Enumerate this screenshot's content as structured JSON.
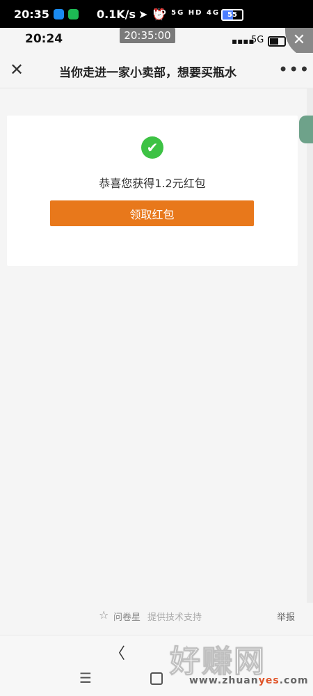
{
  "status_bar": {
    "time": "20:35",
    "speed": "0.1K/s",
    "network_icons": "HD 5G HD 4G",
    "battery": "55",
    "battery_level": 0.55
  },
  "inner_status": {
    "time": "20:24",
    "network": "5G"
  },
  "overlay_time": "20:35:00",
  "nav": {
    "title": "当你走进一家小卖部，想要买瓶水"
  },
  "card": {
    "result_text": "恭喜您获得1.2元红包",
    "claim_label": "领取红包"
  },
  "footer": {
    "brand": "问卷星",
    "support": "提供技术支持",
    "report": "举报"
  },
  "watermark": {
    "text": "好赚网",
    "url_prefix": "www.zhuan",
    "url_accent": "yes",
    "url_suffix": ".com"
  }
}
